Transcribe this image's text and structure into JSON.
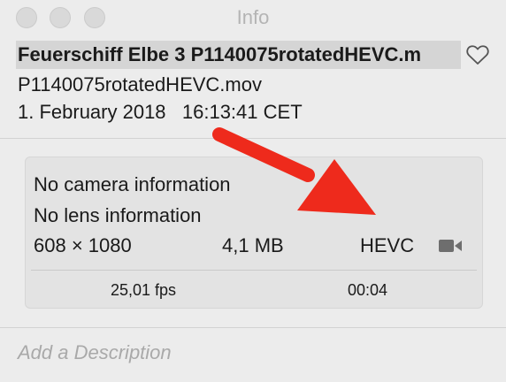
{
  "window": {
    "title": "Info"
  },
  "header": {
    "title": "Feuerschiff Elbe 3 P1140075rotatedHEVC.m",
    "filename": "P1140075rotatedHEVC.mov",
    "datetime": "1. February 2018   16:13:41 CET"
  },
  "metadata": {
    "camera": "No camera information",
    "lens": "No lens information",
    "dimensions": "608 × 1080",
    "size": "4,1 MB",
    "codec": "HEVC",
    "fps": "25,01 fps",
    "duration": "00:04"
  },
  "description": {
    "placeholder": "Add a Description"
  },
  "icons": {
    "favorite": "heart-icon",
    "media": "video-camera-icon"
  },
  "colors": {
    "annotation_arrow": "#ee2a1c",
    "title_highlight": "#d5d5d5"
  }
}
